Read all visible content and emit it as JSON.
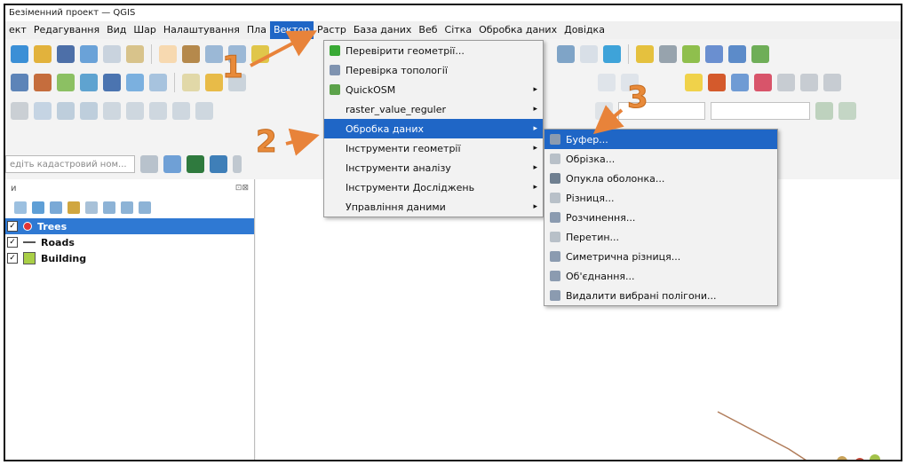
{
  "window": {
    "title": "Безіменний проект — QGIS"
  },
  "menubar": {
    "items": [
      "ект",
      "Редагування",
      "Вид",
      "Шар",
      "Налаштування",
      "Пла",
      "Вектор",
      "Растр",
      "База даних",
      "Веб",
      "Сітка",
      "Обробка даних",
      "Довідка"
    ],
    "active": "Вектор"
  },
  "search": {
    "placeholder": "едіть кадастровий ном..."
  },
  "layers_panel": {
    "title": "и",
    "layers": [
      {
        "name": "Trees",
        "checked": true,
        "selected": true,
        "swatch": "#e23434"
      },
      {
        "name": "Roads",
        "checked": true,
        "selected": false,
        "swatch": "line"
      },
      {
        "name": "Building",
        "checked": true,
        "selected": false,
        "swatch": "#a9cf46"
      }
    ]
  },
  "vector_menu": {
    "items": [
      {
        "label": "Перевірити геометрії...",
        "submenu": false,
        "icon": "check-geometry-icon"
      },
      {
        "label": "Перевірка топології",
        "submenu": false,
        "icon": "topology-icon"
      },
      {
        "label": "QuickOSM",
        "submenu": true,
        "icon": "quickosm-icon"
      },
      {
        "label": "raster_value_reguler",
        "submenu": true,
        "icon": ""
      },
      {
        "label": "Обробка даних",
        "submenu": true,
        "icon": "",
        "highlighted": true
      },
      {
        "label": "Інструменти геометрії",
        "submenu": true,
        "icon": ""
      },
      {
        "label": "Інструменти аналізу",
        "submenu": true,
        "icon": ""
      },
      {
        "label": "Інструменти Досліджень",
        "submenu": true,
        "icon": ""
      },
      {
        "label": "Управління даними",
        "submenu": true,
        "icon": ""
      }
    ]
  },
  "geoprocessing_menu": {
    "items": [
      {
        "label": "Буфер...",
        "highlighted": true
      },
      {
        "label": "Обрізка..."
      },
      {
        "label": "Опукла оболонка..."
      },
      {
        "label": "Різниця..."
      },
      {
        "label": "Розчинення..."
      },
      {
        "label": "Перетин..."
      },
      {
        "label": "Симетрична різниця..."
      },
      {
        "label": "Об'єднання..."
      },
      {
        "label": "Видалити вибрані полігони..."
      }
    ]
  },
  "annotations": {
    "step1": "1",
    "step2": "2",
    "step3": "3"
  },
  "colors": {
    "accent": "#1f66c6",
    "arrow": "#e8833a"
  }
}
